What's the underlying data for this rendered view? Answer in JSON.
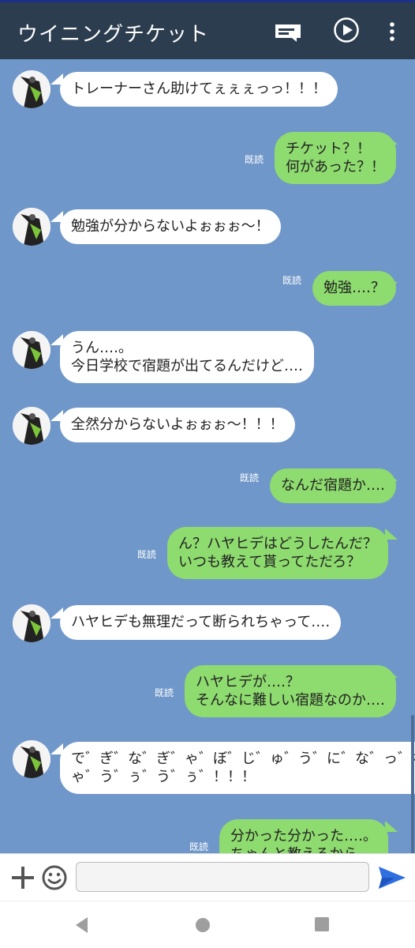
{
  "header": {
    "title": "ウイニングチケット",
    "icons": [
      "menu-card-icon",
      "play-circle-icon",
      "more-vertical-icon"
    ]
  },
  "messages": [
    {
      "side": "left",
      "lines": [
        "トレーナーさん助けてぇぇぇっっ！！！"
      ]
    },
    {
      "side": "right",
      "read": "既読",
      "lines": [
        "チケット？！",
        "何があった？！"
      ]
    },
    {
      "side": "left",
      "lines": [
        "勉強が分からないよぉぉぉ～！"
      ]
    },
    {
      "side": "right",
      "read": "既読",
      "lines": [
        "勉強‥‥？"
      ]
    },
    {
      "side": "left",
      "lines": [
        "うん‥‥。",
        "今日学校で宿題が出てるんだけど‥‥"
      ]
    },
    {
      "side": "left",
      "lines": [
        "全然分からないよぉぉぉ～！！！"
      ]
    },
    {
      "side": "right",
      "read": "既読",
      "lines": [
        "なんだ宿題か‥‥"
      ]
    },
    {
      "side": "right",
      "read": "既読",
      "lines": [
        "ん？ハヤヒデはどうしたんだ？",
        "いつも教えて貰ってただろ？"
      ]
    },
    {
      "side": "left",
      "lines": [
        "ハヤヒデも無理だって断られちゃって‥‥"
      ]
    },
    {
      "side": "right",
      "read": "既読",
      "lines": [
        "ハヤヒデが‥‥？",
        "そんなに難しい宿題なのか‥‥"
      ]
    },
    {
      "side": "left",
      "lines": [
        "で゛ぎ゛な゛ぎ゛ゃ゛ぼ゛じ゛ゅ゛う゛に゛な゛っ゛ぢ゛",
        "ゃ゛う゛ぅ゛う゛ぅ゛！！！"
      ]
    },
    {
      "side": "right",
      "read": "既読",
      "lines": [
        "分かった分かった‥‥。",
        "ちゃんと教えるから"
      ]
    }
  ],
  "input": {
    "placeholder": ""
  },
  "colors": {
    "header_bg": "#2c3d50",
    "chat_bg": "#6f97c9",
    "bubble_left": "#ffffff",
    "bubble_right": "#8edb6f",
    "send": "#2f6fe0"
  }
}
